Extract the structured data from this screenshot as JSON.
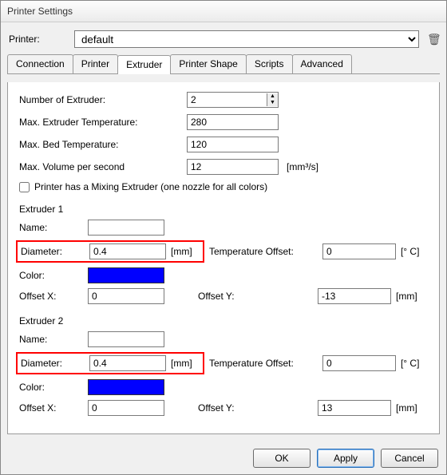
{
  "window": {
    "title": "Printer Settings"
  },
  "printer": {
    "label": "Printer:",
    "selected": "default"
  },
  "icons": {
    "delete": "🗑"
  },
  "tabs": {
    "connection": "Connection",
    "printer": "Printer",
    "extruder": "Extruder",
    "printer_shape": "Printer Shape",
    "scripts": "Scripts",
    "advanced": "Advanced"
  },
  "fields": {
    "num_ext_label": "Number of Extruder:",
    "num_ext_value": "2",
    "max_ext_temp_label": "Max. Extruder Temperature:",
    "max_ext_temp_value": "280",
    "max_bed_temp_label": "Max. Bed Temperature:",
    "max_bed_temp_value": "120",
    "max_vol_label": "Max. Volume per second",
    "max_vol_value": "12",
    "max_vol_unit": "[mm³/s]",
    "mix_label": "Printer has a Mixing Extruder (one nozzle for all colors)"
  },
  "ext_labels": {
    "name": "Name:",
    "diameter": "Diameter:",
    "diam_unit": "[mm]",
    "temp_off": "Temperature Offset:",
    "temp_unit": "[° C]",
    "color": "Color:",
    "offx": "Offset X:",
    "offy": "Offset Y:",
    "off_unit": "[mm]"
  },
  "ext1": {
    "title": "Extruder 1",
    "name": "",
    "diameter": "0.4",
    "temp_offset": "0",
    "color": "#0000ff",
    "offx": "0",
    "offy": "-13"
  },
  "ext2": {
    "title": "Extruder 2",
    "name": "",
    "diameter": "0.4",
    "temp_offset": "0",
    "color": "#0000ff",
    "offx": "0",
    "offy": "13"
  },
  "buttons": {
    "ok": "OK",
    "apply": "Apply",
    "cancel": "Cancel"
  }
}
